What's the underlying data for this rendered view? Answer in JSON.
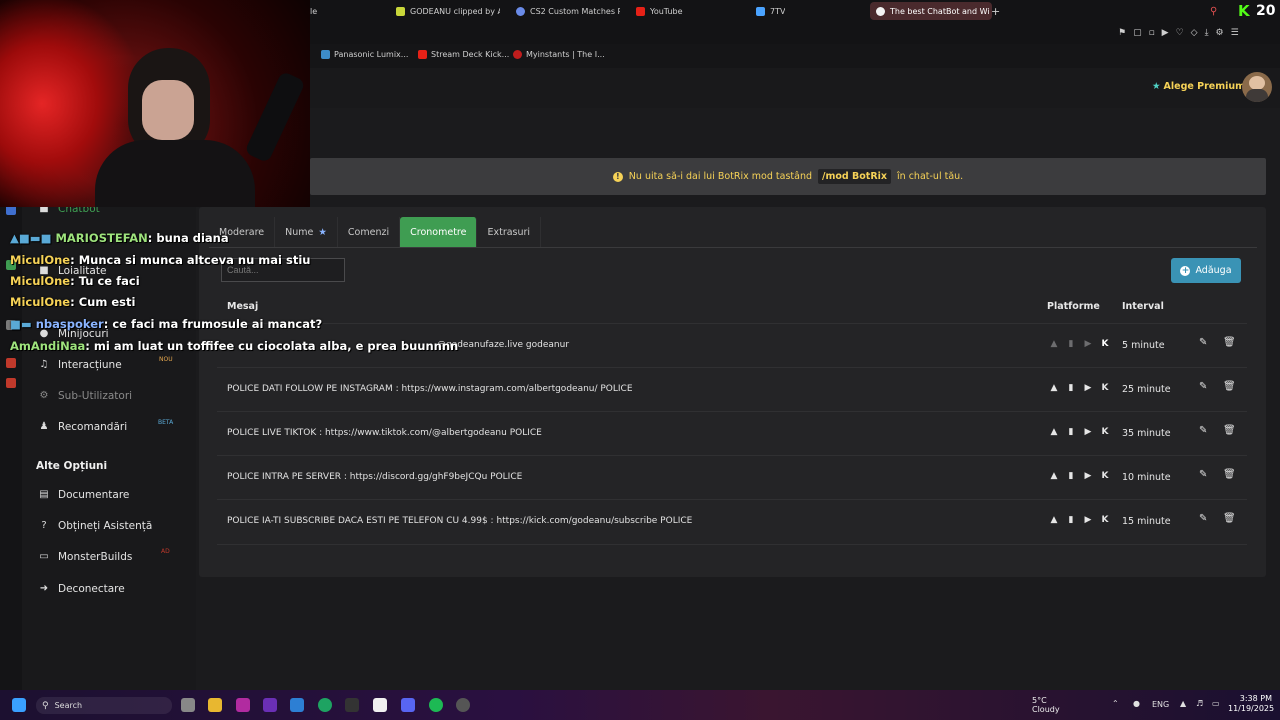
{
  "browser": {
    "tabs": [
      {
        "label": "le"
      },
      {
        "label": "GODEANU clipped by Alb"
      },
      {
        "label": "CS2 Custom Matches Pr"
      },
      {
        "label": "YouTube"
      },
      {
        "label": "7TV"
      },
      {
        "label": "The best ChatBot and Wi"
      }
    ],
    "new_tab": "+",
    "bookmarks": [
      {
        "label": "Panasonic Lumix..."
      },
      {
        "label": "Stream Deck Kick..."
      },
      {
        "label": "Myinstants | The I..."
      }
    ],
    "corner_logo": "K",
    "corner_count": "20"
  },
  "header": {
    "premium_label": "Alege Premium"
  },
  "banner": {
    "text_before": "Nu uita să-i dai lui BotRix mod tastând",
    "command": "/mod BotRix",
    "text_after": "în chat-ul tău."
  },
  "tabs": [
    {
      "label": "Moderare",
      "active": false
    },
    {
      "label": "Nume",
      "active": false
    },
    {
      "label": "Comenzi",
      "active": false
    },
    {
      "label": "Cronometre",
      "active": true
    },
    {
      "label": "Extrasuri",
      "active": false
    }
  ],
  "search": {
    "placeholder": "Caută..."
  },
  "add_button": "Adăuga",
  "table": {
    "headers": {
      "message": "Mesaj",
      "platforms": "Platforme",
      "interval": "Interval"
    },
    "rows": [
      {
        "message": "@godeanufaze.live godeanur",
        "interval": "5 minute"
      },
      {
        "message": "POLICE DATI FOLLOW PE INSTAGRAM : https://www.instagram.com/albertgodeanu/ POLICE",
        "interval": "25 minute"
      },
      {
        "message": "POLICE LIVE TIKTOK : https://www.tiktok.com/@albertgodeanu POLICE",
        "interval": "35 minute"
      },
      {
        "message": "POLICE INTRA PE SERVER : https://discord.gg/ghF9beJCQu POLICE",
        "interval": "10 minute"
      },
      {
        "message": "POLICE IA-TI SUBSCRIBE DACA ESTI PE TELEFON CU 4.99$ : https://kick.com/godeanu/subscribe POLICE",
        "interval": "15 minute"
      }
    ]
  },
  "sidebar": {
    "items": [
      {
        "label": "Chatbot"
      },
      {
        "label": "Loialitate"
      },
      {
        "label": "Minijocuri"
      },
      {
        "label": "Interacțiune",
        "badge": "NOU"
      },
      {
        "label": "Sub-Utilizatori"
      },
      {
        "label": "Recomandări",
        "badge": "BETA"
      }
    ],
    "section_title": "Alte Opțiuni",
    "other": [
      {
        "label": "Documentare"
      },
      {
        "label": "Obțineți Asistență"
      },
      {
        "label": "MonsterBuilds",
        "badge": "AD"
      },
      {
        "label": "Deconectare"
      }
    ]
  },
  "chat": [
    {
      "name": "MARIOSTEFAN",
      "text": "buna diana"
    },
    {
      "name": "MiculOne",
      "text": "Munca si munca altceva nu mai stiu"
    },
    {
      "name": "MiculOne",
      "text": "Tu ce faci"
    },
    {
      "name": "MiculOne",
      "text": "Cum esti"
    },
    {
      "name": "nbaspoker",
      "text": "ce faci ma frumosule ai mancat?"
    },
    {
      "name": "AmAndiNaa",
      "text": "mi am luat un toffifee cu ciocolata alba, e prea buunnnn"
    }
  ],
  "taskbar": {
    "search": "Search",
    "weather_temp": "5°C",
    "weather_desc": "Cloudy",
    "lang": "ENG",
    "time": "3:38 PM",
    "date": "11/19/2025"
  }
}
